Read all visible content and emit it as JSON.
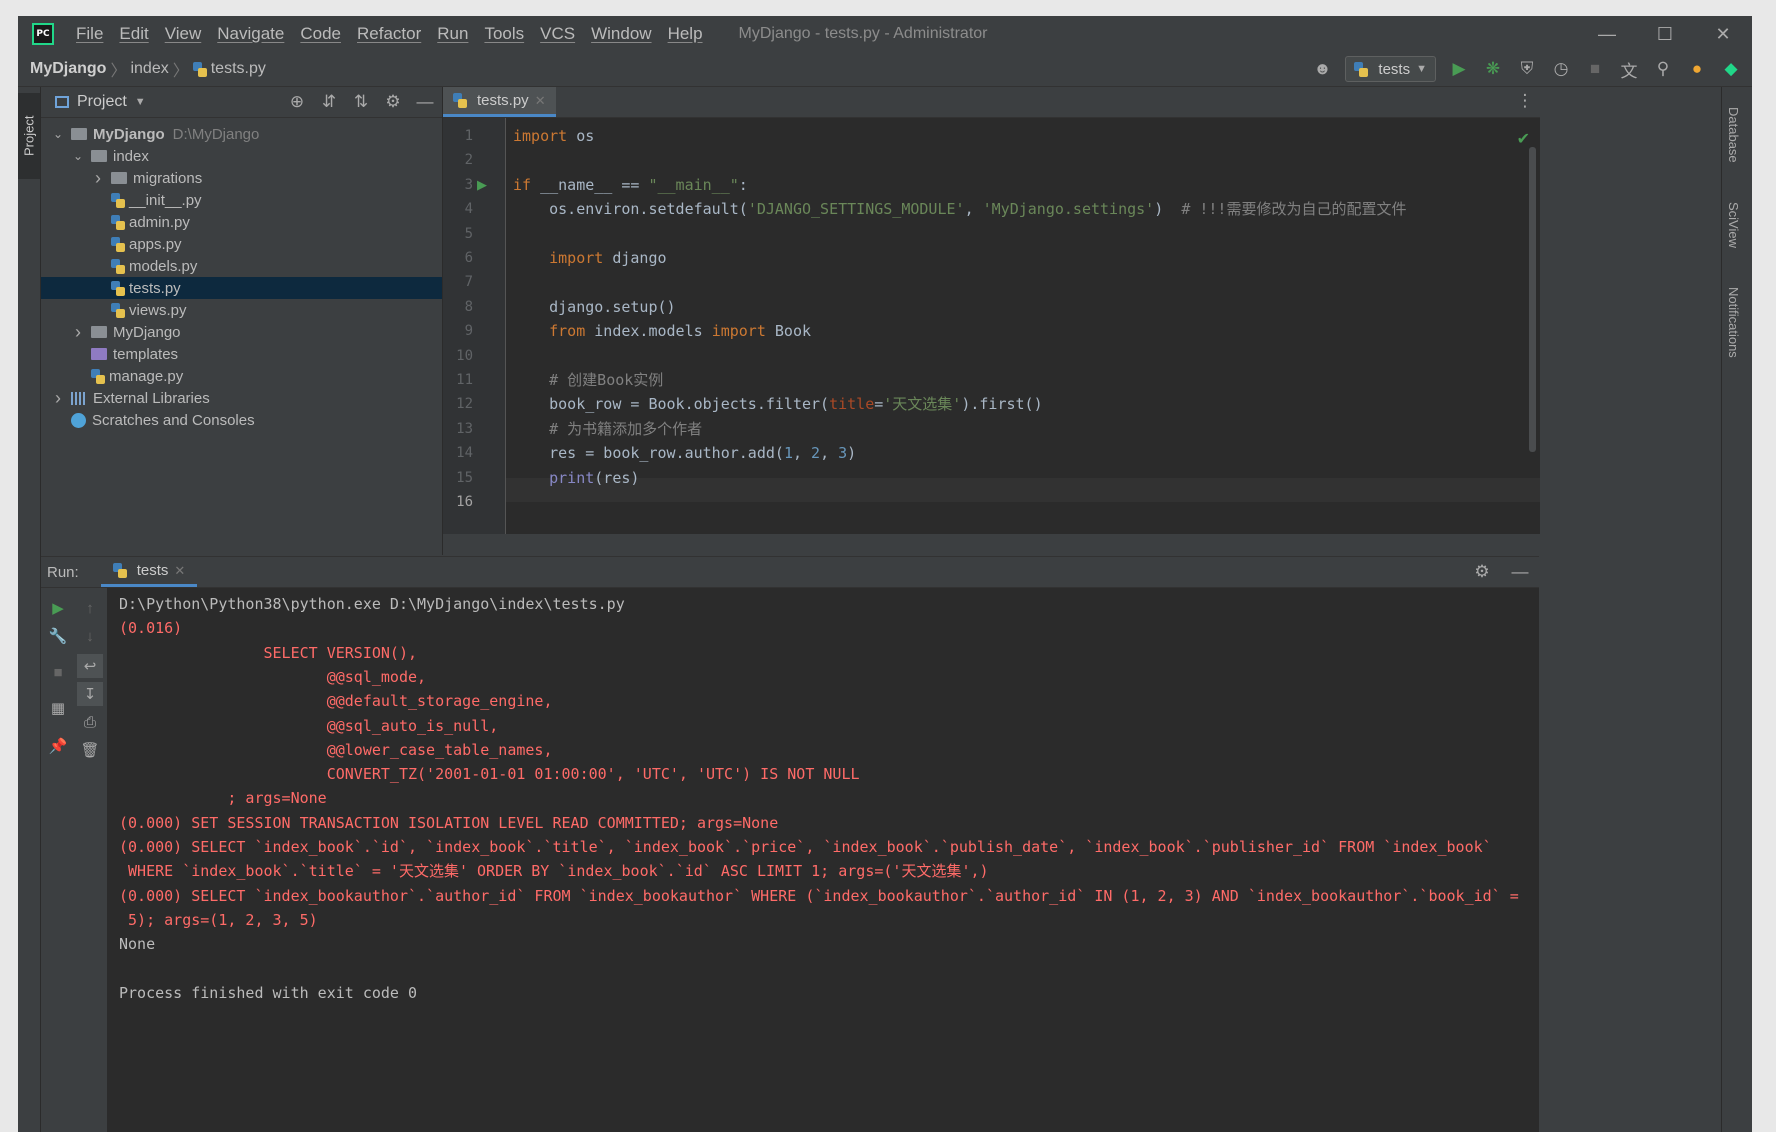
{
  "app": {
    "logo_text": "PC",
    "menu": [
      "File",
      "Edit",
      "View",
      "Navigate",
      "Code",
      "Refactor",
      "Run",
      "Tools",
      "VCS",
      "Window",
      "Help"
    ],
    "window_title": "MyDjango - tests.py - Administrator"
  },
  "breadcrumb": {
    "project": "MyDjango",
    "folder": "index",
    "file": "tests.py"
  },
  "run_config": {
    "name": "tests"
  },
  "left_strip": {
    "project_tab": "Project"
  },
  "right_strip": {
    "database": "Database",
    "sciview": "SciView",
    "notifications": "Notifications"
  },
  "project_panel": {
    "title": "Project",
    "tree": [
      {
        "label": "MyDjango",
        "path": "D:\\MyDjango",
        "kind": "root-folder",
        "expanded": true,
        "level": 0
      },
      {
        "label": "index",
        "kind": "folder",
        "expanded": true,
        "level": 1
      },
      {
        "label": "migrations",
        "kind": "folder",
        "expanded": false,
        "level": 2
      },
      {
        "label": "__init__.py",
        "kind": "py",
        "level": 2
      },
      {
        "label": "admin.py",
        "kind": "py",
        "level": 2
      },
      {
        "label": "apps.py",
        "kind": "py",
        "level": 2
      },
      {
        "label": "models.py",
        "kind": "py",
        "level": 2
      },
      {
        "label": "tests.py",
        "kind": "py",
        "level": 2,
        "selected": true
      },
      {
        "label": "views.py",
        "kind": "py",
        "level": 2
      },
      {
        "label": "MyDjango",
        "kind": "folder",
        "expanded": false,
        "level": 1
      },
      {
        "label": "templates",
        "kind": "folder-purple",
        "level": 1
      },
      {
        "label": "manage.py",
        "kind": "py",
        "level": 1
      },
      {
        "label": "External Libraries",
        "kind": "lib",
        "expanded": false,
        "level": 0
      },
      {
        "label": "Scratches and Consoles",
        "kind": "scratch",
        "level": 0
      }
    ]
  },
  "editor": {
    "tab": "tests.py",
    "line_numbers": [
      "1",
      "2",
      "3",
      "4",
      "5",
      "6",
      "7",
      "8",
      "9",
      "10",
      "11",
      "12",
      "13",
      "14",
      "15",
      "16"
    ],
    "code_lines": [
      [
        [
          "kw",
          "import"
        ],
        [
          "t",
          " os"
        ]
      ],
      [],
      [
        [
          "kw",
          "if"
        ],
        [
          "t",
          " __name__ == "
        ],
        [
          "str",
          "\"__main__\""
        ],
        [
          "t",
          ":"
        ]
      ],
      [
        [
          "t",
          "    os.environ.setdefault("
        ],
        [
          "str",
          "'DJANGO_SETTINGS_MODULE'"
        ],
        [
          "t",
          ", "
        ],
        [
          "str",
          "'MyDjango.settings'"
        ],
        [
          "t",
          ")  "
        ],
        [
          "cmt",
          "# !!!需要修改为自己的配置文件"
        ]
      ],
      [],
      [
        [
          "t",
          "    "
        ],
        [
          "kw",
          "import"
        ],
        [
          "t",
          " django"
        ]
      ],
      [],
      [
        [
          "t",
          "    django.setup()"
        ]
      ],
      [
        [
          "t",
          "    "
        ],
        [
          "kw",
          "from"
        ],
        [
          "t",
          " index.models "
        ],
        [
          "kw",
          "import"
        ],
        [
          "t",
          " Book"
        ]
      ],
      [],
      [
        [
          "t",
          "    "
        ],
        [
          "cmt",
          "# 创建Book实例"
        ]
      ],
      [
        [
          "t",
          "    book_row = Book.objects.filter("
        ],
        [
          "param",
          "title"
        ],
        [
          "t",
          "="
        ],
        [
          "str",
          "'天文选集'"
        ],
        [
          "t",
          ").first()"
        ]
      ],
      [
        [
          "t",
          "    "
        ],
        [
          "cmt",
          "# 为书籍添加多个作者"
        ]
      ],
      [
        [
          "t",
          "    res = book_row.author.add("
        ],
        [
          "num",
          "1"
        ],
        [
          "t",
          ", "
        ],
        [
          "num",
          "2"
        ],
        [
          "t",
          ", "
        ],
        [
          "num",
          "3"
        ],
        [
          "t",
          ")"
        ]
      ],
      [
        [
          "t",
          "    "
        ],
        [
          "bi",
          "print"
        ],
        [
          "t",
          "(res)"
        ]
      ],
      []
    ]
  },
  "run_panel": {
    "label": "Run:",
    "tab": "tests",
    "output": [
      {
        "text": "D:\\Python\\Python38\\python.exe D:\\MyDjango\\index\\tests.py",
        "err": false
      },
      {
        "text": "(0.016)",
        "err": true
      },
      {
        "text": "                SELECT VERSION(),",
        "err": true
      },
      {
        "text": "                       @@sql_mode,",
        "err": true
      },
      {
        "text": "                       @@default_storage_engine,",
        "err": true
      },
      {
        "text": "                       @@sql_auto_is_null,",
        "err": true
      },
      {
        "text": "                       @@lower_case_table_names,",
        "err": true
      },
      {
        "text": "                       CONVERT_TZ('2001-01-01 01:00:00', 'UTC', 'UTC') IS NOT NULL",
        "err": true
      },
      {
        "text": "            ; args=None",
        "err": true
      },
      {
        "text": "(0.000) SET SESSION TRANSACTION ISOLATION LEVEL READ COMMITTED; args=None",
        "err": true
      },
      {
        "text": "(0.000) SELECT `index_book`.`id`, `index_book`.`title`, `index_book`.`price`, `index_book`.`publish_date`, `index_book`.`publisher_id` FROM `index_book`",
        "err": true
      },
      {
        "text": " WHERE `index_book`.`title` = '天文选集' ORDER BY `index_book`.`id` ASC LIMIT 1; args=('天文选集',)",
        "err": true
      },
      {
        "text": "(0.000) SELECT `index_bookauthor`.`author_id` FROM `index_bookauthor` WHERE (`index_bookauthor`.`author_id` IN (1, 2, 3) AND `index_bookauthor`.`book_id` =",
        "err": true
      },
      {
        "text": " 5); args=(1, 2, 3, 5)",
        "err": true
      },
      {
        "text": "None",
        "err": false
      },
      {
        "text": "",
        "err": false
      },
      {
        "text": "Process finished with exit code 0",
        "err": false
      }
    ]
  }
}
